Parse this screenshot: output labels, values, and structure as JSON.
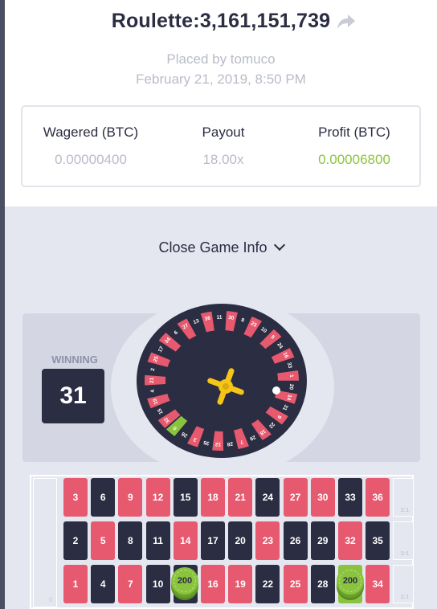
{
  "header": {
    "title": "Roulette:3,161,151,739",
    "placed_by": "Placed by tomuco",
    "date": "February 21, 2019, 8:50 PM"
  },
  "stats": [
    {
      "label": "Wagered (BTC)",
      "value": "0.00000400"
    },
    {
      "label": "Payout",
      "value": "18.00x"
    },
    {
      "label": "Profit (BTC)",
      "value": "0.00006800"
    }
  ],
  "close_info": "Close Game Info",
  "winning": {
    "label": "WINNING",
    "number": "31"
  },
  "wheel_numbers": [
    "0",
    "32",
    "15",
    "19",
    "4",
    "21",
    "2",
    "25",
    "17",
    "34",
    "6",
    "27",
    "13",
    "36",
    "11",
    "30",
    "8",
    "23",
    "10",
    "5",
    "24",
    "16",
    "33",
    "1",
    "20",
    "14",
    "31",
    "9",
    "22",
    "18",
    "29",
    "7",
    "28",
    "12",
    "35",
    "3",
    "26"
  ],
  "table": {
    "row_top": [
      "3",
      "6",
      "9",
      "12",
      "15",
      "18",
      "21",
      "24",
      "27",
      "30",
      "33",
      "36"
    ],
    "row_mid": [
      "2",
      "5",
      "8",
      "11",
      "14",
      "17",
      "20",
      "23",
      "26",
      "29",
      "32",
      "35"
    ],
    "row_bot": [
      "1",
      "4",
      "7",
      "10",
      "13",
      "16",
      "19",
      "22",
      "25",
      "28",
      "31",
      "34"
    ],
    "zero_label": "0",
    "column_bet_label": "2:1",
    "chip_value": "200"
  },
  "colors": {
    "red": "#e7596e",
    "black": "#2b2d42",
    "green": "#8ac43f"
  }
}
